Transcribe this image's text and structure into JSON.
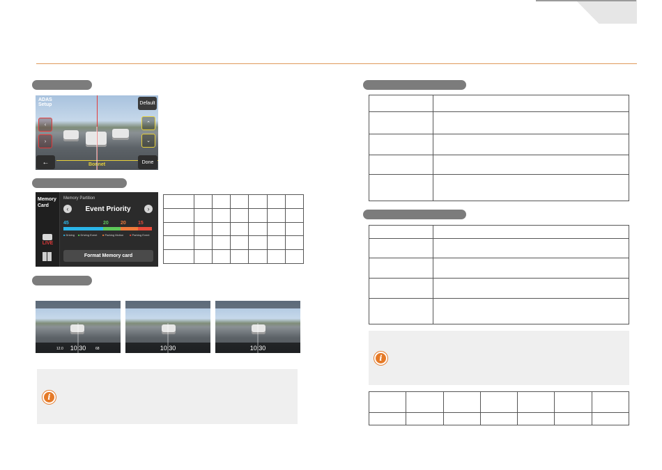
{
  "adas_screen": {
    "title": "ADAS\nSetup",
    "default_label": "Default",
    "bonnet_label": "Bonnet",
    "done_label": "Done"
  },
  "memory_screen": {
    "sidebar_title": "Memory\nCard",
    "live_label": "LIVE",
    "partition_label": "Memory Partition",
    "mode_title": "Event Priority",
    "values": [
      "45",
      "20",
      "20",
      "15"
    ],
    "legend": [
      "Driving",
      "Driving Event",
      "Parking Motion",
      "Parking Event"
    ],
    "format_button": "Format Memory card",
    "bar_colors": [
      "#2bb5e8",
      "#5ec85a",
      "#f07a3a",
      "#e84a3a"
    ]
  },
  "live_screens": [
    {
      "time": "10:30",
      "temp": "12.0",
      "counter": "68"
    },
    {
      "time": "10:30"
    },
    {
      "time": "10:30"
    }
  ],
  "colors": {
    "accent_orange": "#e57a28",
    "rule_orange": "#e09a5a"
  }
}
